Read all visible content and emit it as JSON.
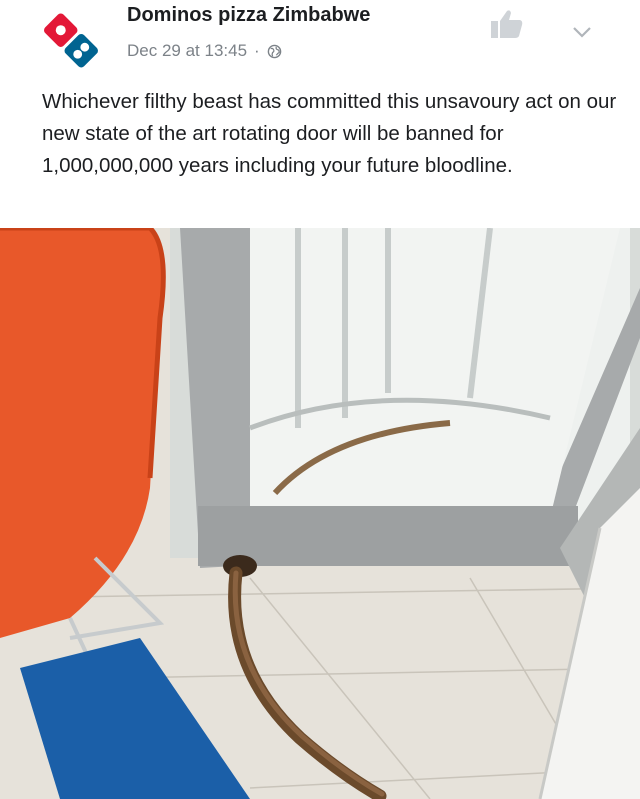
{
  "post": {
    "page_name": "Dominos pizza Zimbabwe",
    "date": "Dec 29 at 13:45",
    "separator": "·",
    "text": "Whichever filthy beast has committed this unsavoury act on our new state of the art rotating door will be banned for 1,000,000,000 years including your future bloodline.",
    "icons": {
      "logo": "dominos-logo",
      "privacy": "globe-icon",
      "like": "thumbs-up-icon",
      "menu": "chevron-down-icon"
    }
  },
  "colors": {
    "logo_red": "#e31837",
    "logo_blue": "#006491",
    "chair_orange": "#e8582a",
    "mat_blue": "#1b5fa8",
    "smear_brown": "#6b4a2b"
  }
}
